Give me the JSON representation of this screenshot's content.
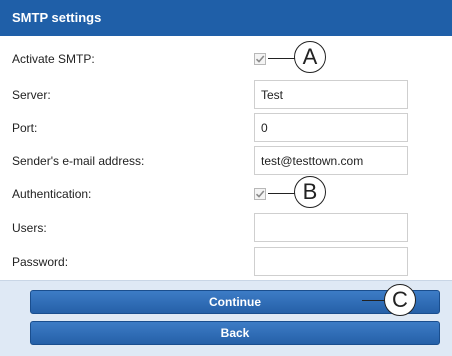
{
  "header": {
    "title": "SMTP settings"
  },
  "form": {
    "activate_smtp": {
      "label": "Activate SMTP:",
      "checked": true
    },
    "server": {
      "label": "Server:",
      "value": "Test"
    },
    "port": {
      "label": "Port:",
      "value": "0"
    },
    "sender_email": {
      "label": "Sender's e-mail address:",
      "value": "test@testtown.com"
    },
    "authentication": {
      "label": "Authentication:",
      "checked": true
    },
    "users": {
      "label": "Users:",
      "value": ""
    },
    "password": {
      "label": "Password:",
      "value": ""
    }
  },
  "buttons": {
    "continue_label": "Continue",
    "back_label": "Back"
  },
  "callouts": {
    "a": "A",
    "b": "B",
    "c": "C"
  },
  "colors": {
    "header_bg": "#1f5fa8",
    "button_bg": "#2f6db5",
    "footer_bg": "#dfe9f5"
  }
}
